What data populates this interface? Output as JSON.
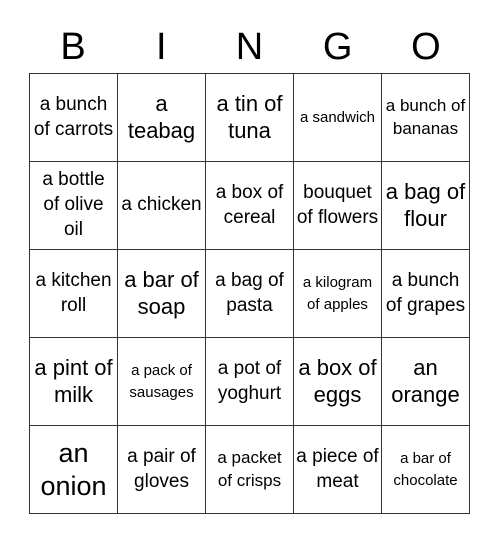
{
  "header": {
    "letters": [
      "B",
      "I",
      "N",
      "G",
      "O"
    ]
  },
  "cells": [
    [
      {
        "text": "a bunch of carrots",
        "size": "m"
      },
      {
        "text": "a teabag",
        "size": "l"
      },
      {
        "text": "a tin of tuna",
        "size": "l"
      },
      {
        "text": "a sandwich",
        "size": "xs"
      },
      {
        "text": "a bunch of bananas",
        "size": "s"
      }
    ],
    [
      {
        "text": "a bottle of olive oil",
        "size": "m"
      },
      {
        "text": "a chicken",
        "size": "m"
      },
      {
        "text": "a box of cereal",
        "size": "m"
      },
      {
        "text": "bouquet of flowers",
        "size": "m"
      },
      {
        "text": "a bag of flour",
        "size": "l"
      }
    ],
    [
      {
        "text": "a kitchen roll",
        "size": "m"
      },
      {
        "text": "a bar of soap",
        "size": "l"
      },
      {
        "text": "a bag of pasta",
        "size": "m"
      },
      {
        "text": "a kilogram of apples",
        "size": "xs"
      },
      {
        "text": "a bunch of grapes",
        "size": "m"
      }
    ],
    [
      {
        "text": "a pint of milk",
        "size": "l"
      },
      {
        "text": "a pack of sausages",
        "size": "xs"
      },
      {
        "text": "a pot of yoghurt",
        "size": "m"
      },
      {
        "text": "a box of eggs",
        "size": "l"
      },
      {
        "text": "an orange",
        "size": "l"
      }
    ],
    [
      {
        "text": "an onion",
        "size": "xl"
      },
      {
        "text": "a pair of gloves",
        "size": "m"
      },
      {
        "text": "a packet of crisps",
        "size": "s"
      },
      {
        "text": "a piece of meat",
        "size": "m"
      },
      {
        "text": "a bar of chocolate",
        "size": "xs"
      }
    ]
  ]
}
